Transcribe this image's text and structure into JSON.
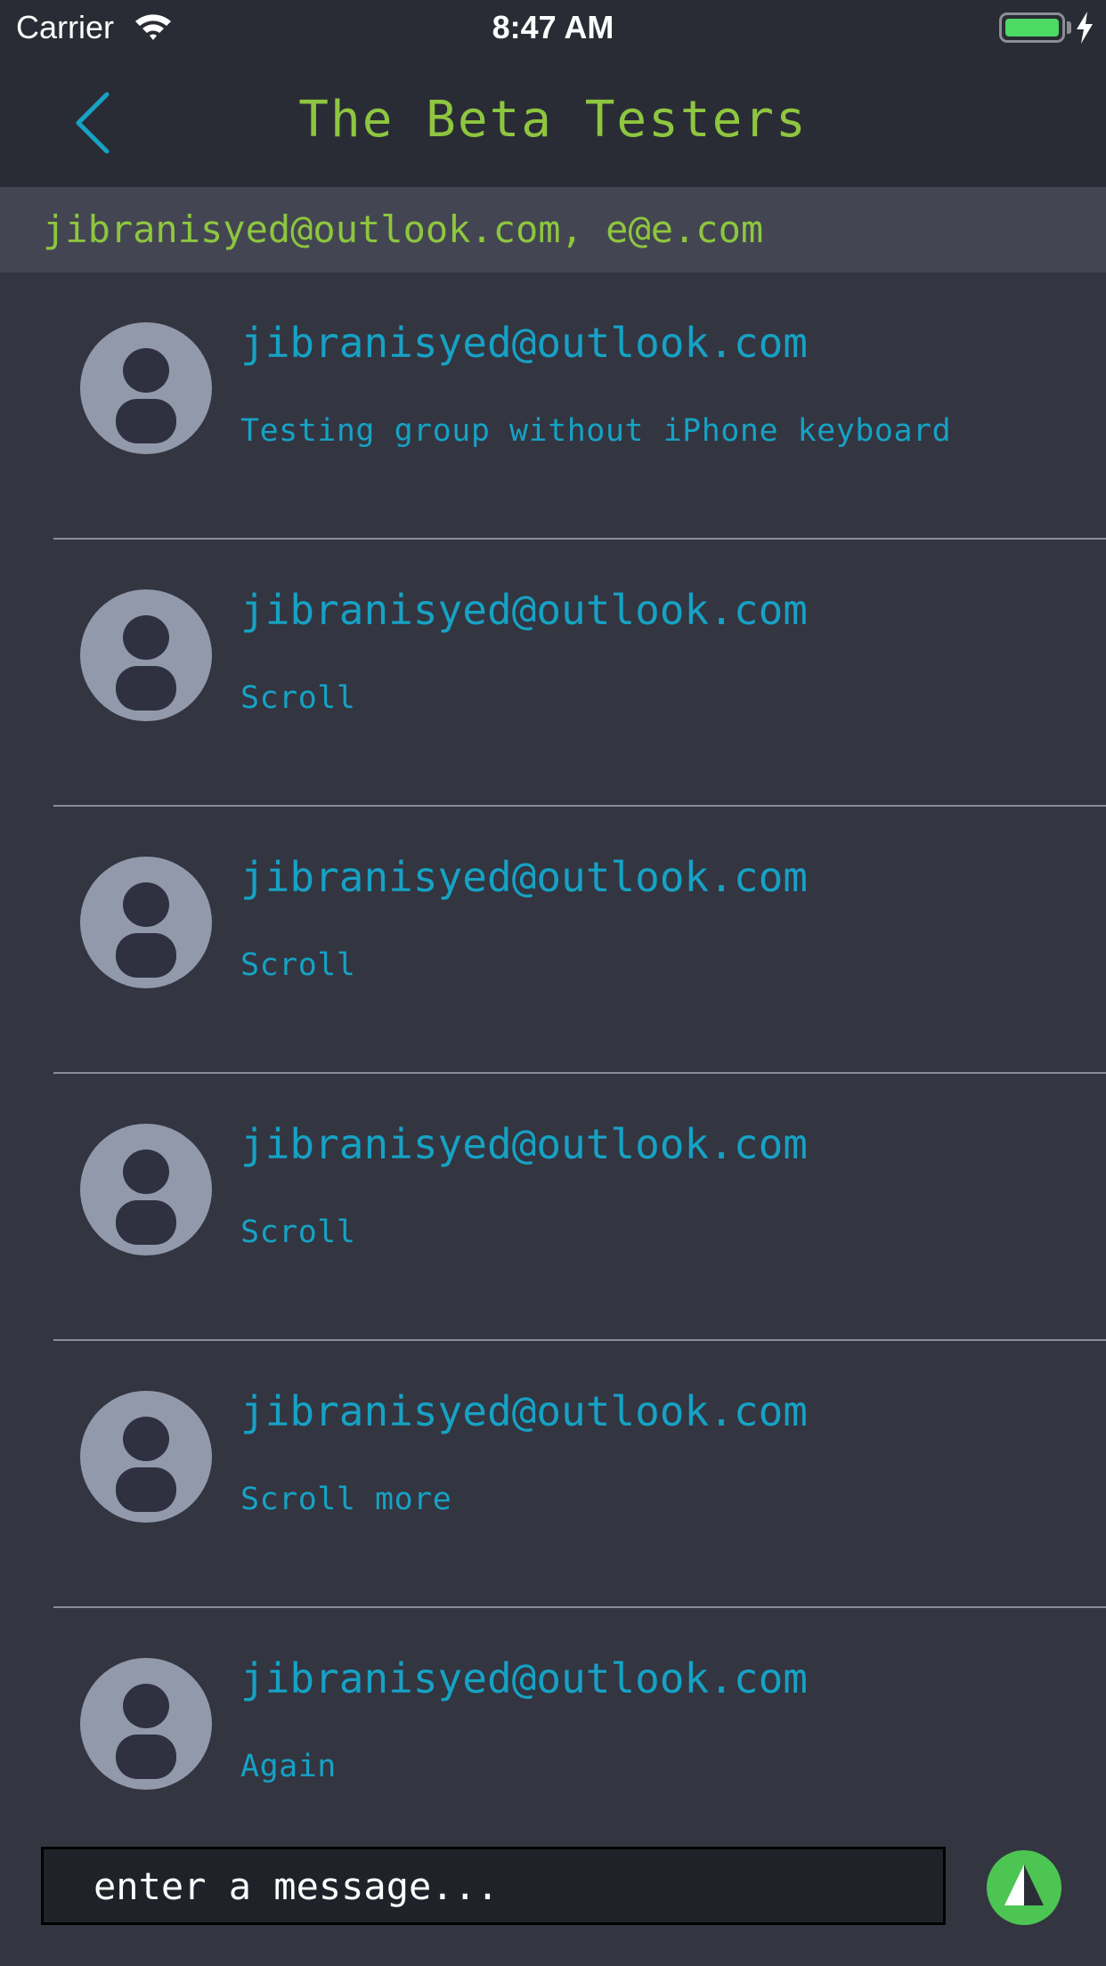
{
  "status_bar": {
    "carrier": "Carrier",
    "time": "8:47 AM",
    "battery_level": 1.0,
    "charging": true
  },
  "nav": {
    "title": "The Beta Testers",
    "back_icon": "chevron-left-icon"
  },
  "members": "jibranisyed@outlook.com, e@e.com",
  "messages": [
    {
      "sender": "jibranisyed@outlook.com",
      "text": "Testing group without iPhone keyboard"
    },
    {
      "sender": "jibranisyed@outlook.com",
      "text": "Scroll"
    },
    {
      "sender": "jibranisyed@outlook.com",
      "text": "Scroll"
    },
    {
      "sender": "jibranisyed@outlook.com",
      "text": "Scroll"
    },
    {
      "sender": "jibranisyed@outlook.com",
      "text": "Scroll more"
    },
    {
      "sender": "jibranisyed@outlook.com",
      "text": "Again"
    }
  ],
  "composer": {
    "placeholder": "enter a message...",
    "send_icon": "send-icon"
  },
  "colors": {
    "background": "#333541",
    "nav_background": "#2a2c35",
    "members_background": "#434652",
    "title_green": "#8ec63f",
    "accent_blue": "#16a2c4",
    "avatar_grey": "#9299ab",
    "send_green": "#4cc553"
  }
}
